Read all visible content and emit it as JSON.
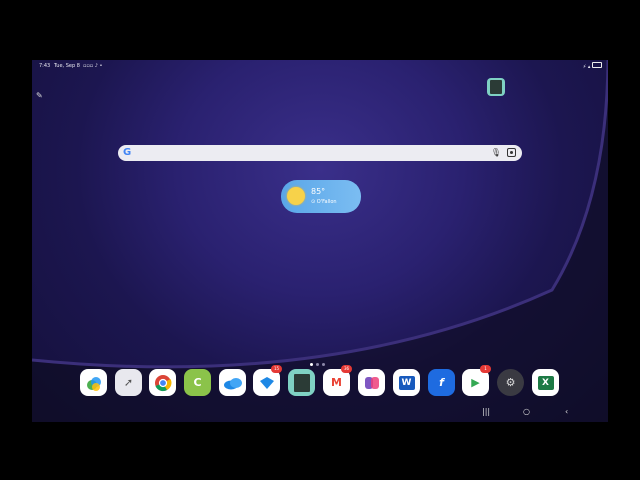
{
  "status": {
    "time": "7:43",
    "date": "Tue, Sep 8"
  },
  "search": {
    "logo": "G",
    "mic_icon": "microphone-icon",
    "lens_icon": "lens-icon"
  },
  "weather": {
    "temperature": "85°",
    "location": "O'Fallon"
  },
  "pages": {
    "count": 3,
    "current": 1
  },
  "dock": {
    "apps": [
      {
        "name": "Photos",
        "icon": "photos-icon"
      },
      {
        "name": "Perplexity",
        "icon": "compass-icon"
      },
      {
        "name": "Chrome",
        "icon": "chrome-icon"
      },
      {
        "name": "Comet",
        "icon": "comet-icon",
        "glyph": "C"
      },
      {
        "name": "OneDrive",
        "icon": "cloud-icon"
      },
      {
        "name": "Copilot Tasks",
        "icon": "task-icon",
        "badge": "15"
      },
      {
        "name": "Calendar",
        "icon": "calendar-icon"
      },
      {
        "name": "Gmail",
        "icon": "gmail-icon",
        "glyph": "M",
        "badge": "36"
      },
      {
        "name": "Copilot",
        "icon": "copilot-icon"
      },
      {
        "name": "Word",
        "icon": "word-icon",
        "glyph": "W"
      },
      {
        "name": "Fender",
        "icon": "f-icon",
        "glyph": "f"
      },
      {
        "name": "Play Store",
        "icon": "play-icon",
        "glyph": "▶",
        "badge": "1"
      },
      {
        "name": "Settings",
        "icon": "gear-icon",
        "glyph": "⚙"
      },
      {
        "name": "Excel",
        "icon": "excel-icon",
        "glyph": "X"
      }
    ]
  },
  "navbar": {
    "recents": "|||",
    "home": "○",
    "back": "‹"
  }
}
